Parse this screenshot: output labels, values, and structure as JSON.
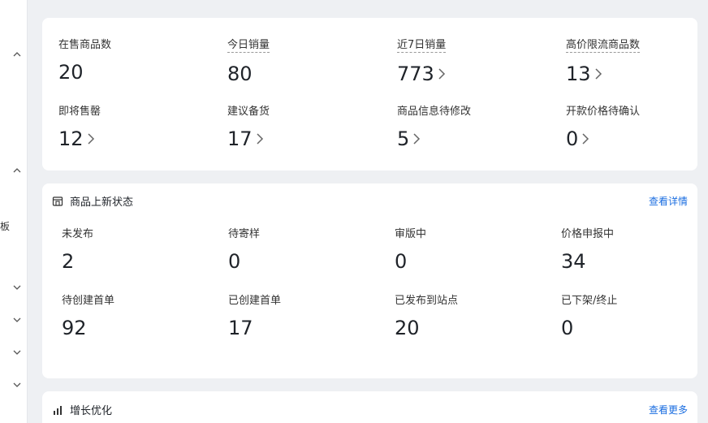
{
  "stats": {
    "items": [
      {
        "label": "在售商品数",
        "value": "20"
      },
      {
        "label": "今日销量",
        "value": "80"
      },
      {
        "label": "近7日销量",
        "value": "773"
      },
      {
        "label": "高价限流商品数",
        "value": "13"
      },
      {
        "label": "即将售罄",
        "value": "12"
      },
      {
        "label": "建议备货",
        "value": "17"
      },
      {
        "label": "商品信息待修改",
        "value": "5"
      },
      {
        "label": "开款价格待确认",
        "value": "0"
      }
    ]
  },
  "new_status": {
    "title": "商品上新状态",
    "link": "查看详情",
    "items": [
      {
        "label": "未发布",
        "value": "2"
      },
      {
        "label": "待寄样",
        "value": "0"
      },
      {
        "label": "审版中",
        "value": "0"
      },
      {
        "label": "价格申报中",
        "value": "34"
      },
      {
        "label": "待创建首单",
        "value": "92"
      },
      {
        "label": "已创建首单",
        "value": "17"
      },
      {
        "label": "已发布到站点",
        "value": "20"
      },
      {
        "label": "已下架/终止",
        "value": "0"
      }
    ]
  },
  "growth": {
    "title": "增长优化",
    "link": "查看更多"
  },
  "sidebar": {
    "partial_text": "板"
  },
  "colors": {
    "link": "#1a6de0",
    "page_bg": "#eef0f3",
    "card_bg": "#ffffff"
  }
}
